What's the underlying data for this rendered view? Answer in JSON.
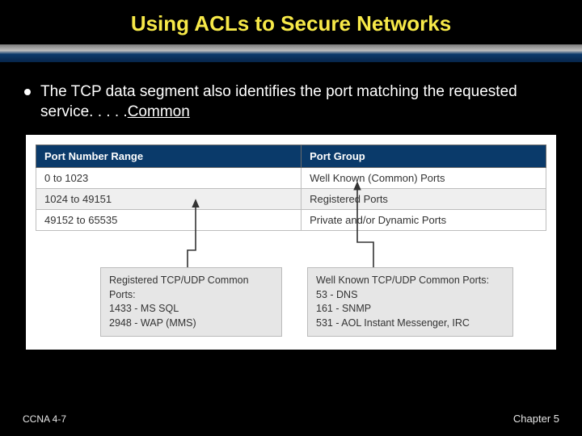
{
  "title": "Using ACLs to Secure Networks",
  "bullet": {
    "text_a": "The TCP data segment also identifies the port matching the requested service. . . . .",
    "text_u": "Common"
  },
  "table": {
    "headers": {
      "col1": "Port Number Range",
      "col2": "Port Group"
    },
    "rows": [
      {
        "range": "0 to 1023",
        "group": "Well Known (Common) Ports"
      },
      {
        "range": "1024 to 49151",
        "group": "Registered Ports"
      },
      {
        "range": "49152 to 65535",
        "group": "Private and/or Dynamic Ports"
      }
    ]
  },
  "leftbox": {
    "title": "Registered TCP/UDP Common Ports:",
    "l1": "1433 - MS SQL",
    "l2": "2948 - WAP (MMS)"
  },
  "rightbox": {
    "title": "Well Known TCP/UDP Common Ports:",
    "l1": "53 - DNS",
    "l2": "161 - SNMP",
    "l3": "531 - AOL Instant Messenger, IRC"
  },
  "footer": {
    "left": "CCNA 4-7",
    "right": "Chapter 5"
  }
}
